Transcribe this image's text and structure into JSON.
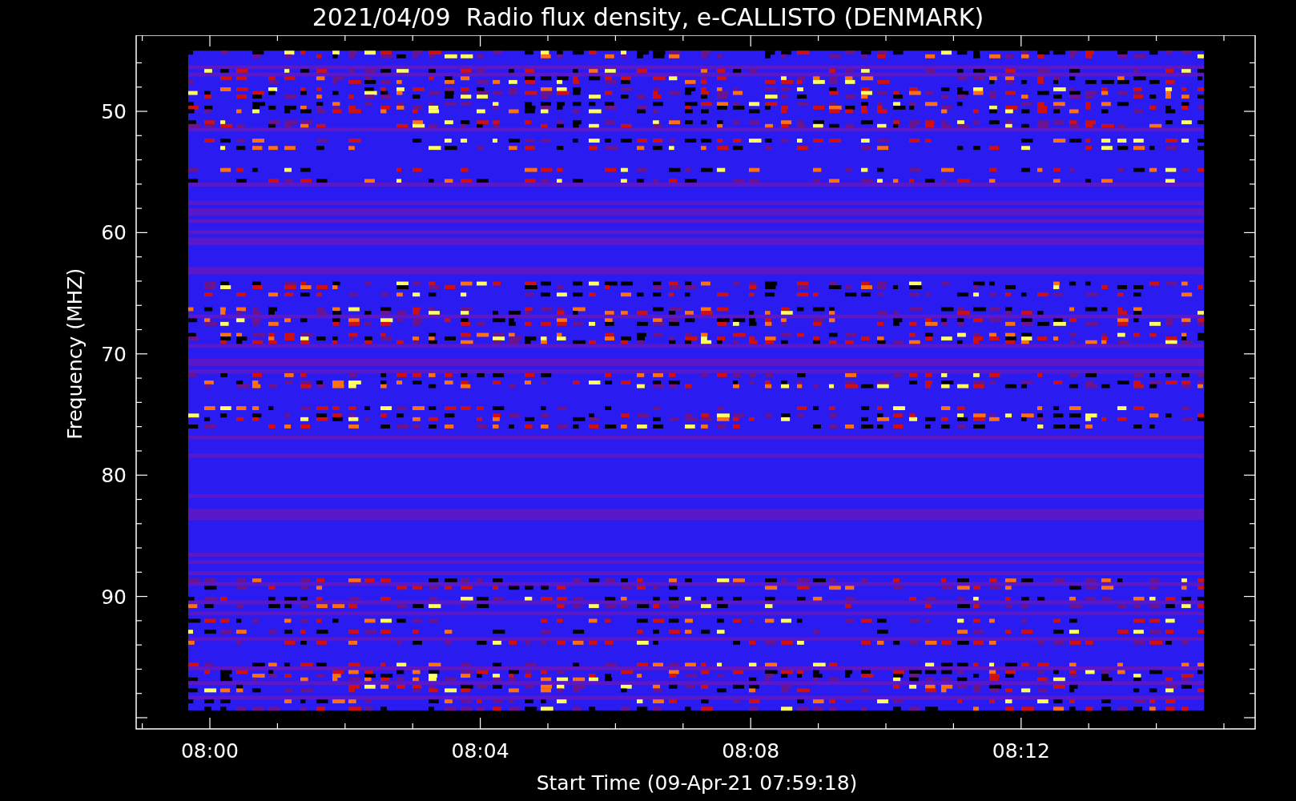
{
  "title": "2021/04/09  Radio flux density, e-CALLISTO (DENMARK)",
  "plot": {
    "xlabel": "Start Time (09-Apr-21 07:59:18)",
    "ylabel": "Frequency (MHZ)",
    "xtick_labels": [
      "08:00",
      "08:04",
      "08:08",
      "08:12"
    ],
    "ytick_labels": [
      "50",
      "60",
      "70",
      "80",
      "90"
    ]
  }
}
